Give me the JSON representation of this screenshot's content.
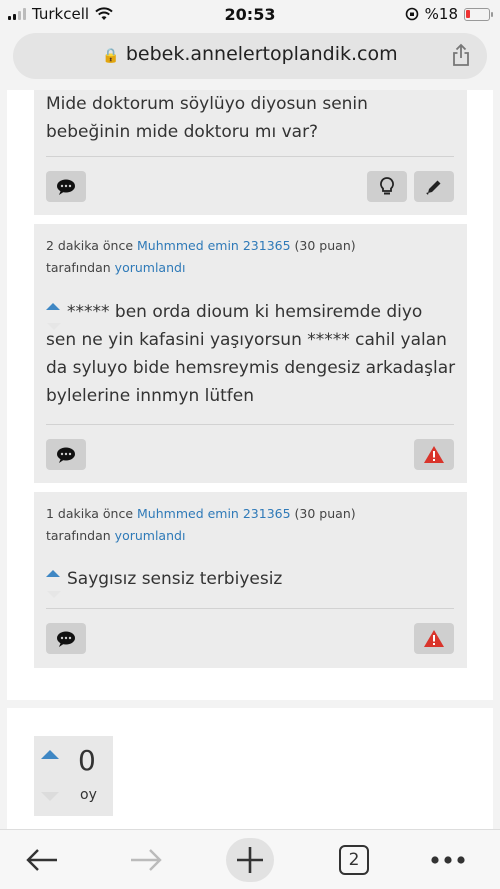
{
  "status": {
    "carrier": "Turkcell",
    "time": "20:53",
    "battery": "%18"
  },
  "browser": {
    "url": "bebek.annelertoplandik.com",
    "tab_count": "2"
  },
  "question_tail": {
    "text": "Mide doktorum söylüyo diyosun senin bebeğinin mide doktoru mı var?"
  },
  "comments": [
    {
      "time": "2 dakika önce",
      "user": "Muhmmed emin 231365",
      "points": "(30 puan)",
      "by": "tarafından",
      "action": "yorumlandı",
      "text": "***** ben orda dioum ki hemsiremde diyo sen ne yin kafasini yaşıyorsun ***** cahil yalan da syluyo bide hemsreymis dengesiz arkadaşlar bylelerine innmyn lütfen"
    },
    {
      "time": "1 dakika önce",
      "user": "Muhmmed emin 231365",
      "points": "(30 puan)",
      "by": "tarafından",
      "action": "yorumlandı",
      "text": "Saygısız sensiz terbiyesiz"
    }
  ],
  "answer_votes": {
    "count": "0",
    "label": "oy"
  },
  "colors": {
    "link": "#2f7ab8",
    "flag": "#d9342b",
    "vote_up": "#3f87c4"
  }
}
